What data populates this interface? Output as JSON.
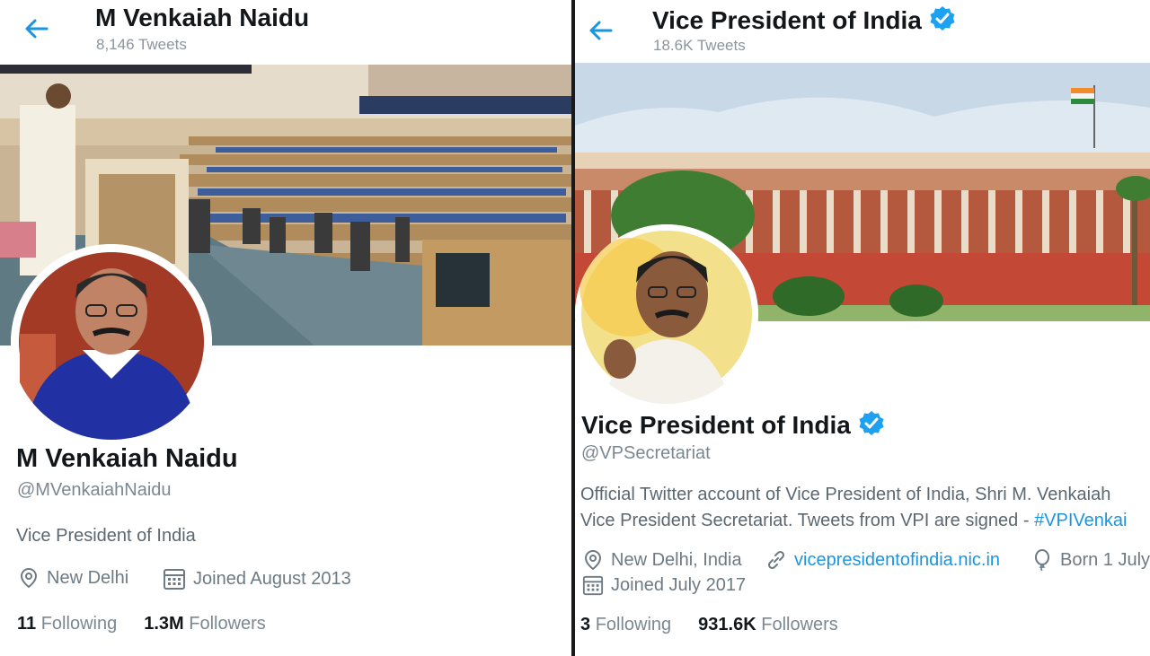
{
  "left": {
    "header": {
      "name": "M Venkaiah Naidu",
      "tweet_count": "8,146 Tweets"
    },
    "profile": {
      "display_name": "M Venkaiah Naidu",
      "handle": "@MVenkaiahNaidu",
      "bio": "Vice President of India",
      "location": "New Delhi",
      "joined": "Joined August 2013",
      "following_count": "11",
      "following_label": "Following",
      "followers_count": "1.3M",
      "followers_label": "Followers"
    },
    "icons": {
      "back": "back-arrow-icon",
      "location": "location-pin-icon",
      "joined": "calendar-icon"
    }
  },
  "right": {
    "header": {
      "name": "Vice President of India",
      "tweet_count": "18.6K Tweets"
    },
    "profile": {
      "display_name": "Vice President of India",
      "handle": "@VPSecretariat",
      "bio_line1": "Official Twitter account of Vice President of India, Shri M. Venkaiah",
      "bio_line2": "Vice President Secretariat. Tweets from VPI are signed - ",
      "bio_hashtag": "#VPIVenkai",
      "location": "New Delhi, India",
      "website": "vicepresidentofindia.nic.in",
      "born": "Born 1 July",
      "joined": "Joined July 2017",
      "following_count": "3",
      "following_label": "Following",
      "followers_count": "931.6K",
      "followers_label": "Followers"
    },
    "icons": {
      "back": "back-arrow-icon",
      "verified": "verified-badge-icon",
      "location": "location-pin-icon",
      "website": "link-icon",
      "born": "balloon-icon",
      "joined": "calendar-icon"
    }
  },
  "colors": {
    "accent": "#1b95e0",
    "verified": "#1da1f2",
    "text_primary": "#14171a",
    "text_secondary": "#7b8891"
  }
}
